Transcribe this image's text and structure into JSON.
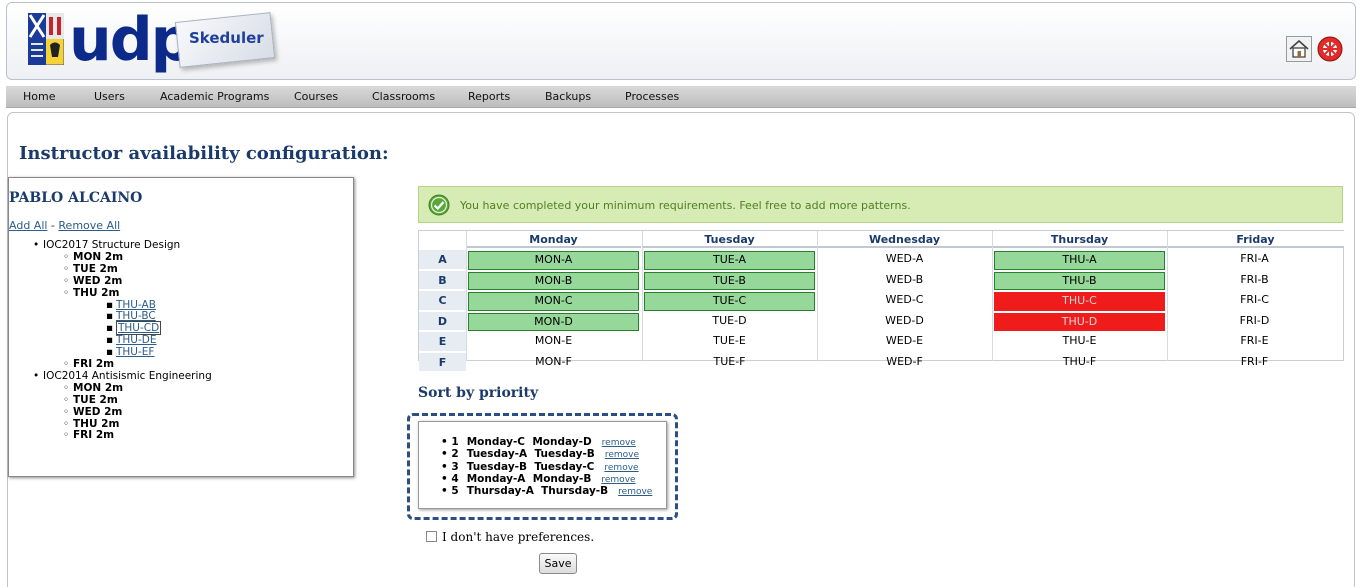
{
  "header": {
    "logo_text": "udp",
    "app_badge": "Skeduler"
  },
  "nav": [
    "Home",
    "Users",
    "Academic Programs",
    "Courses",
    "Classrooms",
    "Reports",
    "Backups",
    "Processes"
  ],
  "page_title": "Instructor availability configuration:",
  "instructor": {
    "name": "PABLO ALCAINO",
    "add_all": "Add All",
    "separator": " - ",
    "remove_all": "Remove All"
  },
  "tree": [
    {
      "level": 1,
      "text": "IOC2017 Structure Design"
    },
    {
      "level": 2,
      "text": "MON 2m"
    },
    {
      "level": 2,
      "text": "TUE 2m"
    },
    {
      "level": 2,
      "text": "WED 2m"
    },
    {
      "level": 2,
      "text": "THU 2m"
    },
    {
      "level": 3,
      "text": "THU-AB",
      "link": true
    },
    {
      "level": 3,
      "text": "THU-BC",
      "link": true
    },
    {
      "level": 3,
      "text": "THU-CD",
      "link": true,
      "selected": true
    },
    {
      "level": 3,
      "text": "THU-DE",
      "link": true
    },
    {
      "level": 3,
      "text": "THU-EF",
      "link": true
    },
    {
      "level": 2,
      "text": "FRI 2m"
    },
    {
      "level": 1,
      "text": "IOC2014 Antisismic Engineering"
    },
    {
      "level": 2,
      "text": "MON 2m"
    },
    {
      "level": 2,
      "text": "TUE 2m"
    },
    {
      "level": 2,
      "text": "WED 2m"
    },
    {
      "level": 2,
      "text": "THU 2m"
    },
    {
      "level": 2,
      "text": "FRI 2m"
    }
  ],
  "banner": {
    "text": "You have completed your minimum requirements. Feel free to add more patterns."
  },
  "schedule": {
    "days": [
      "Monday",
      "Tuesday",
      "Wednesday",
      "Thursday",
      "Friday"
    ],
    "rows": [
      {
        "label": "A",
        "cells": [
          {
            "text": "MON-A",
            "state": "green"
          },
          {
            "text": "TUE-A",
            "state": "green"
          },
          {
            "text": "WED-A",
            "state": "none"
          },
          {
            "text": "THU-A",
            "state": "green"
          },
          {
            "text": "FRI-A",
            "state": "none"
          }
        ]
      },
      {
        "label": "B",
        "cells": [
          {
            "text": "MON-B",
            "state": "green"
          },
          {
            "text": "TUE-B",
            "state": "green"
          },
          {
            "text": "WED-B",
            "state": "none"
          },
          {
            "text": "THU-B",
            "state": "green"
          },
          {
            "text": "FRI-B",
            "state": "none"
          }
        ]
      },
      {
        "label": "C",
        "cells": [
          {
            "text": "MON-C",
            "state": "green"
          },
          {
            "text": "TUE-C",
            "state": "green"
          },
          {
            "text": "WED-C",
            "state": "none"
          },
          {
            "text": "THU-C",
            "state": "red"
          },
          {
            "text": "FRI-C",
            "state": "none"
          }
        ]
      },
      {
        "label": "D",
        "cells": [
          {
            "text": "MON-D",
            "state": "green"
          },
          {
            "text": "TUE-D",
            "state": "none"
          },
          {
            "text": "WED-D",
            "state": "none"
          },
          {
            "text": "THU-D",
            "state": "red"
          },
          {
            "text": "FRI-D",
            "state": "none"
          }
        ]
      },
      {
        "label": "E",
        "cells": [
          {
            "text": "MON-E",
            "state": "none"
          },
          {
            "text": "TUE-E",
            "state": "none"
          },
          {
            "text": "WED-E",
            "state": "none"
          },
          {
            "text": "THU-E",
            "state": "none"
          },
          {
            "text": "FRI-E",
            "state": "none"
          }
        ]
      },
      {
        "label": "F",
        "cells": [
          {
            "text": "MON-F",
            "state": "none"
          },
          {
            "text": "TUE-F",
            "state": "none"
          },
          {
            "text": "WED-F",
            "state": "none"
          },
          {
            "text": "THU-F",
            "state": "none"
          },
          {
            "text": "FRI-F",
            "state": "none"
          }
        ]
      }
    ]
  },
  "sort": {
    "title": "Sort by priority",
    "items": [
      {
        "rank": "1",
        "text": "Monday-C  Monday-D",
        "remove": "remove"
      },
      {
        "rank": "2",
        "text": "Tuesday-A  Tuesday-B",
        "remove": "remove"
      },
      {
        "rank": "3",
        "text": "Tuesday-B  Tuesday-C",
        "remove": "remove"
      },
      {
        "rank": "4",
        "text": "Monday-A  Monday-B",
        "remove": "remove"
      },
      {
        "rank": "5",
        "text": "Thursday-A  Thursday-B",
        "remove": "remove"
      }
    ]
  },
  "preferences": {
    "label": "I don't have preferences.",
    "checked": false
  },
  "save_label": "Save",
  "colors": {
    "selected_green": "#96d79a",
    "conflict_red": "#f01c1c",
    "title_blue": "#1a3a6b",
    "banner_bg": "#d6ecb4"
  },
  "icons": {
    "home": "home-icon",
    "exit": "exit-icon",
    "check": "check-circle-icon",
    "crest": "crest-logo-icon"
  }
}
